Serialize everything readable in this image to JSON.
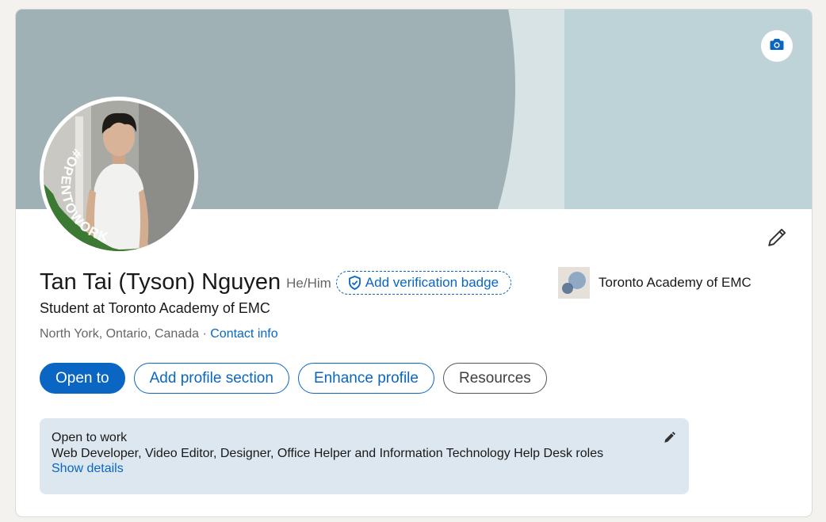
{
  "profile": {
    "name": "Tan Tai (Tyson) Nguyen",
    "pronouns": "He/Him",
    "verify_badge_label": "Add verification badge",
    "headline": "Student at Toronto Academy of EMC",
    "location": "North York, Ontario, Canada",
    "location_separator": " · ",
    "contact_label": "Contact info",
    "company": "Toronto Academy of EMC",
    "avatar_frame_text": "#OPENTOWORK"
  },
  "actions": {
    "open_to": "Open to",
    "add_section": "Add profile section",
    "enhance": "Enhance profile",
    "resources": "Resources"
  },
  "open_to_work": {
    "title": "Open to work",
    "roles": "Web Developer, Video Editor, Designer, Office Helper and Information Technology Help Desk roles",
    "show_details": "Show details"
  },
  "icons": {
    "banner_camera": "camera-icon",
    "edit_intro": "pencil-icon",
    "verify": "shield-check-icon",
    "otw_edit": "pencil-icon"
  },
  "colors": {
    "accent": "#0a66c2",
    "banner_light": "#bdd3d8",
    "banner_dark": "#9fb1b4",
    "open_to_work_green": "#3c7a34",
    "otw_box_bg": "#dde7f0"
  }
}
